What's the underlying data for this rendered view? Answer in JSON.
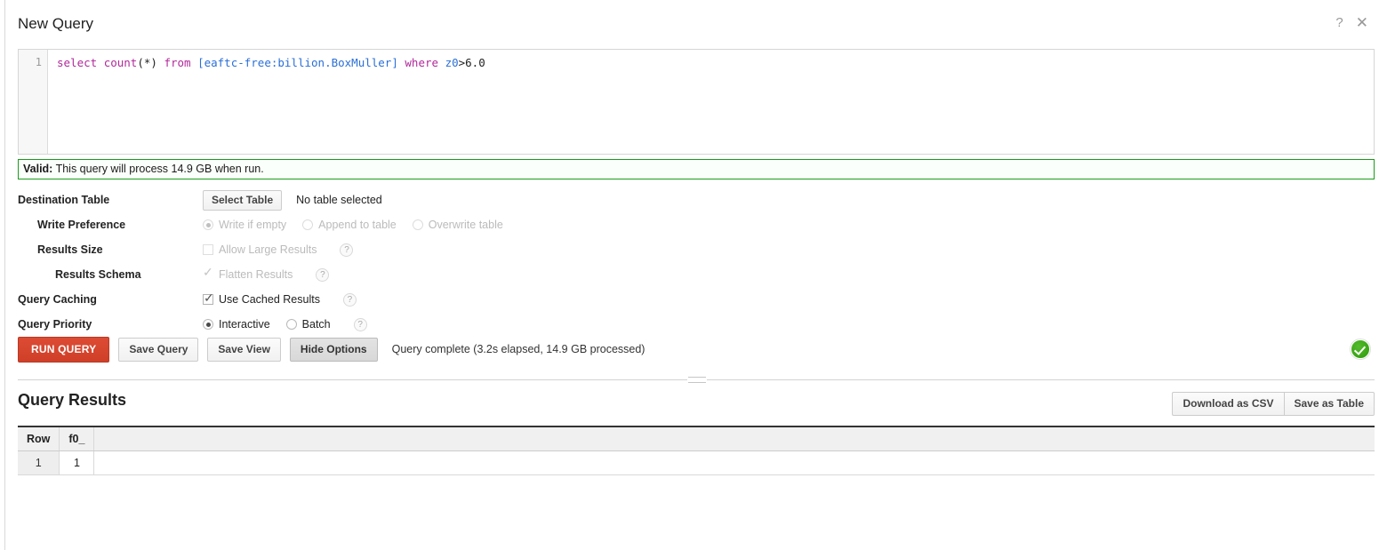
{
  "header": {
    "title": "New Query",
    "help_icon": "question-mark-icon",
    "close_icon": "close-icon"
  },
  "editor": {
    "line_number": "1",
    "query_tokens": [
      {
        "text": "select",
        "type": "keyword"
      },
      {
        "text": " ",
        "type": "plain"
      },
      {
        "text": "count",
        "type": "keyword"
      },
      {
        "text": "(*) ",
        "type": "plain"
      },
      {
        "text": "from",
        "type": "keyword"
      },
      {
        "text": " ",
        "type": "plain"
      },
      {
        "text": "[eaftc-free:billion.BoxMuller]",
        "type": "table"
      },
      {
        "text": " ",
        "type": "plain"
      },
      {
        "text": "where",
        "type": "keyword"
      },
      {
        "text": " ",
        "type": "plain"
      },
      {
        "text": "z0",
        "type": "table"
      },
      {
        "text": ">",
        "type": "operator"
      },
      {
        "text": "6.0",
        "type": "number"
      }
    ],
    "query_text": "select count(*) from [eaftc-free:billion.BoxMuller] where z0>6.0"
  },
  "validation": {
    "status_label": "Valid:",
    "message": "This query will process 14.9 GB when run.",
    "border_color": "#1a9c1a"
  },
  "options": {
    "destination_table": {
      "label": "Destination Table",
      "select_button": "Select Table",
      "value": "No table selected"
    },
    "write_preference": {
      "label": "Write Preference",
      "choices": [
        {
          "label": "Write if empty",
          "selected": true,
          "disabled": true
        },
        {
          "label": "Append to table",
          "selected": false,
          "disabled": true
        },
        {
          "label": "Overwrite table",
          "selected": false,
          "disabled": true
        }
      ]
    },
    "results_size": {
      "label": "Results Size",
      "checkbox_label": "Allow Large Results",
      "checked": false,
      "disabled": true,
      "help": "?"
    },
    "results_schema": {
      "label": "Results Schema",
      "checkbox_label": "Flatten Results",
      "checked": true,
      "disabled": true,
      "help": "?"
    },
    "query_caching": {
      "label": "Query Caching",
      "checkbox_label": "Use Cached Results",
      "checked": true,
      "disabled": false,
      "help": "?"
    },
    "query_priority": {
      "label": "Query Priority",
      "choices": [
        {
          "label": "Interactive",
          "selected": true
        },
        {
          "label": "Batch",
          "selected": false
        }
      ],
      "help": "?"
    }
  },
  "actions": {
    "run_query": "RUN QUERY",
    "save_query": "Save Query",
    "save_view": "Save View",
    "hide_options": "Hide Options",
    "status": "Query complete (3.2s elapsed, 14.9 GB processed)",
    "success_icon": "green-check-circle-icon",
    "run_color": "#d9472f",
    "success_color": "#2fa10a"
  },
  "results": {
    "title": "Query Results",
    "download_csv": "Download as CSV",
    "save_as_table": "Save as Table",
    "columns": [
      "Row",
      "f0_"
    ],
    "rows": [
      {
        "row": "1",
        "f0_": "1"
      }
    ]
  }
}
